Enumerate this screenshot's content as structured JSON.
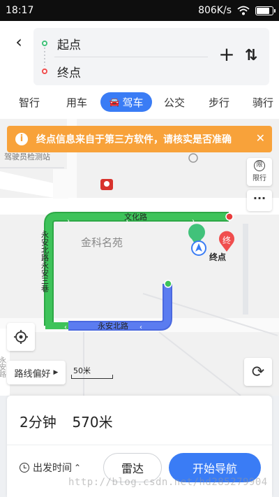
{
  "status_bar": {
    "time": "18:17",
    "network_speed": "806K/s",
    "wifi_icon": "wifi-icon",
    "battery_level": 0.9
  },
  "route": {
    "start_placeholder": "起点",
    "end_placeholder": "终点",
    "start_dot_color": "#41c27a",
    "end_dot_color": "#f04e4e"
  },
  "mode_tabs": [
    {
      "label": "智行",
      "active": false
    },
    {
      "label": "用车",
      "active": false
    },
    {
      "label": "驾车",
      "active": true
    },
    {
      "label": "公交",
      "active": false
    },
    {
      "label": "步行",
      "active": false
    },
    {
      "label": "骑行",
      "active": false
    }
  ],
  "banner": {
    "text": "终点信息来自于第三方软件，请核实是否准确"
  },
  "map": {
    "labels": {
      "driving_school": "驾驶员检测站",
      "community": "金科名苑",
      "road_wenhua": "文化路",
      "road_yongan_north": "永安北路",
      "road_yongan_lane": "永安北路永安三巷",
      "destination": "终点",
      "end_marker": "终",
      "left_road": "永安路"
    },
    "limit_label": "限行",
    "scale_label": "50米",
    "route_pref_label": "路线偏好"
  },
  "summary": {
    "duration": "2分钟",
    "distance": "570米"
  },
  "actions": {
    "depart_time": "出发时间",
    "radar": "雷达",
    "start_nav": "开始导航"
  },
  "watermark": "http://blog.csdn.net/hd285279904",
  "colors": {
    "accent": "#3a7cf5",
    "banner": "#f8a23a",
    "route_green": "#3ec35a",
    "route_blue": "#5b7cf0"
  }
}
